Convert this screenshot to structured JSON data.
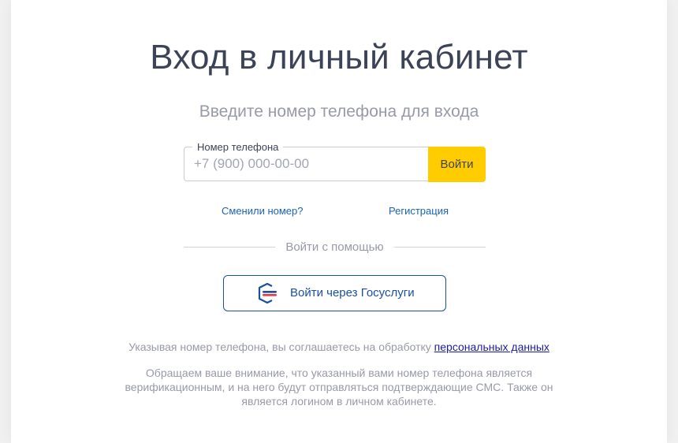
{
  "page": {
    "title": "Вход в личный кабинет",
    "subtitle": "Введите номер телефона для входа"
  },
  "phone_field": {
    "label": "Номер телефона",
    "placeholder": "+7 (900) 000-00-00",
    "value": ""
  },
  "login_button": {
    "label": "Войти"
  },
  "links": {
    "changed_number": "Сменили номер?",
    "register": "Регистрация"
  },
  "divider": {
    "text": "Войти с помощью"
  },
  "gosuslugi_button": {
    "label": "Войти через Госуслуги",
    "icon": "gosuslugi-logo-icon"
  },
  "consent": {
    "text": "Указывая номер телефона, вы соглашаетесь на обработку ",
    "link": "персональных данных"
  },
  "notice": {
    "text": "Обращаем ваше внимание, что указанный вами номер телефона является верификационным, и на него будут отправляться подтверждающие СМС. Также он является логином в личном кабинете."
  },
  "colors": {
    "accent_yellow": "#ffcc00",
    "link_blue": "#1a63b8",
    "gosuslugi_blue": "#1a4fa3",
    "gosuslugi_red": "#e63946",
    "text_dark": "#3d4357",
    "text_muted": "#989aa8"
  }
}
